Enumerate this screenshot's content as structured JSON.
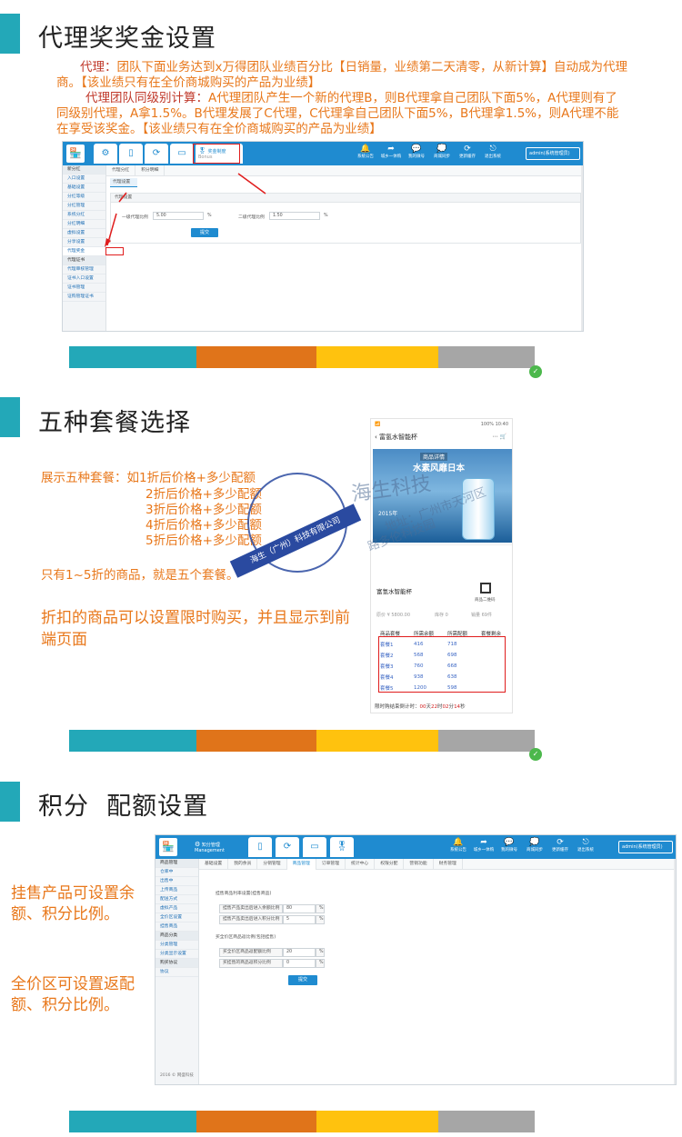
{
  "section1": {
    "title": "代理奖奖金设置",
    "para1_head": "代理：",
    "para1_body": "团队下面业务达到x万得团队业绩百分比【日销量，业绩第二天清零，从新计算】自动成为代理商。【该业绩只有在全价商城购买的产品为业绩】",
    "para2_head": "代理团队同级别计算：",
    "para2_body": "A代理团队产生一个新的代理B，则B代理拿自己团队下面5%，A代理则有了同级别代理，A拿1.5%。B代理发展了C代理，C代理拿自己团队下面5%，B代理拿1.5%，则A代理不能在享受该奖金。【该业绩只有在全价商城购买的产品为业绩】"
  },
  "screen1": {
    "tab_label": "奖金制度",
    "tab_sub": "Bonus",
    "top_icons": [
      {
        "icon": "bell-icon",
        "label": "系统公告"
      },
      {
        "icon": "share-icon",
        "label": "城乡一体购"
      },
      {
        "icon": "comment-icon",
        "label": "我的微号"
      },
      {
        "icon": "chat-icon",
        "label": "商城同步"
      },
      {
        "icon": "refresh-icon",
        "label": "更新缓存"
      },
      {
        "icon": "exit-icon",
        "label": "退出系统"
      }
    ],
    "user": "admin(系统管理员)",
    "crumbs": [
      "代理分红",
      "积分明细"
    ],
    "subtab": "代理设置",
    "panel_title": "代理设置",
    "sidebar": [
      "新分红",
      "入口设置",
      "基础设置",
      "分红等级",
      "分红管理",
      "系统分红",
      "分红明细",
      "虚拟设置",
      "分享设置",
      "代理奖金",
      "代理证书",
      "代理审核管理",
      "证书入口设置",
      "证书管理",
      "证购管理证书"
    ],
    "field1_label": "一级代理比例",
    "field1_value": "5.00",
    "field2_label": "二级代理比例",
    "field2_value": "1.50",
    "unit": "%",
    "submit": "提交"
  },
  "section2": {
    "title": "五种套餐选择",
    "lines": [
      "展示五种套餐：如1折后价格+多少配额",
      "2折后价格+多少配额",
      "3折后价格+多少配额",
      "4折后价格+多少配额",
      "5折后价格+多少配额"
    ],
    "note": "只有1~5折的商品，就是五个套餐。",
    "big": "折扣的商品可以设置限时购买，并且显示到前端页面"
  },
  "phone": {
    "status_left": "📶",
    "status_right": "100%  10:40",
    "nav_title": "富氢水智能杯",
    "banner_top": "商品详情",
    "banner_main": "水素风靡日本",
    "banner_year": "2015年",
    "product_name": "富氢水智能杯",
    "qr_label": "商品二维码",
    "price": "原价 ¥ 5800.00",
    "stock": "库存 0",
    "sales": "销量 69件",
    "headers": [
      "商品套餐",
      "所需余额",
      "所需配额",
      "套餐剩余"
    ],
    "rows": [
      [
        "套餐1",
        "416",
        "718"
      ],
      [
        "套餐2",
        "568",
        "698"
      ],
      [
        "套餐3",
        "760",
        "668"
      ],
      [
        "套餐4",
        "938",
        "638"
      ],
      [
        "套餐5",
        "1200",
        "598"
      ]
    ],
    "countdown_label": "限时购结束倒计时：",
    "cd_d": "00",
    "cd_h": "22",
    "cd_m": "02",
    "cd_s": "14",
    "u_d": "天",
    "u_h": "时",
    "u_m": "分",
    "u_s": "秒"
  },
  "watermark": {
    "brand": "海生科技",
    "addr1": "地址：广州市天河区",
    "addr2": "路多伦科技园",
    "stamp": "海生（广州）科技有限公司"
  },
  "section3": {
    "title": "积分  配额设置",
    "left1": "挂售产品可设置余额、积分比例。",
    "left2": "全价区可设置返配额、积分比例。"
  },
  "screen2": {
    "tab_label": "知分管理",
    "tab_sub": "Management",
    "crumbs": [
      "基础设置",
      "我的余员",
      "分销管理",
      "商品管理",
      "订单管理",
      "统计中心",
      "权限分配",
      "营销功能",
      "财务管理"
    ],
    "sidebar": [
      "商品管理",
      "仓库中",
      "出售中",
      "上传商品",
      "配送方式",
      "虚拟产品",
      "全价区设置",
      "挂售商品",
      "商品分类",
      "分类管理",
      "分类显示设置",
      "购买协议",
      "协议"
    ],
    "footer": "2016 © 网盛科技",
    "sec1_title": "挂售商品利率设置(挂售商品)",
    "f1_label": "挂售产品卖出后进入余额比例",
    "f1_value": "80",
    "f2_label": "挂售产品卖出后进入积分比例",
    "f2_value": "5",
    "sec2_title": "买全价区商品返比例(包括挂售)",
    "f3_label": "买全价区商品返配额比例",
    "f3_value": "20",
    "f4_label": "买挂售的商品返积分比例",
    "f4_value": "0",
    "unit": "%",
    "submit": "提交"
  },
  "colors": {
    "teal": "#23a8b8",
    "orange": "#e0741a",
    "yellow": "#ffc20e",
    "gray": "#a6a6a6",
    "blue": "#1f8bd0",
    "accent_orange": "#e8771a"
  }
}
